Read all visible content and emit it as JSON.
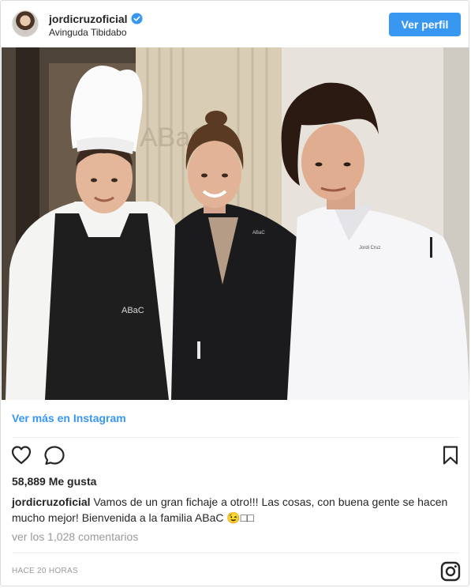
{
  "post": {
    "username": "jordicruzoficial",
    "location": "Avinguda Tibidabo",
    "profile_button": "Ver perfil",
    "photo_texts": {
      "wall_logo": "ABaC",
      "apron_logo": "ABaC",
      "jacket_logo": "ABaC",
      "name_tag": "Jordi Cruz"
    },
    "view_more": "Ver más en Instagram",
    "likes": "58,889 Me gusta",
    "caption_user": "jordicruzoficial",
    "caption_text": "Vamos de un gran fichaje a otro!!! Las cosas, con buena gente se hacen mucho mejor! Bienvenida a la familia ABaC 😉□□",
    "comments_link": "ver los 1,028 comentarios",
    "timestamp": "HACE 20 HORAS"
  },
  "icons": [
    "verified-badge-icon",
    "heart-icon",
    "comment-icon",
    "bookmark-icon",
    "instagram-icon"
  ],
  "colors": {
    "accent": "#3897f0",
    "text": "#262626",
    "muted": "#999999",
    "border": "#dbdbdb"
  }
}
